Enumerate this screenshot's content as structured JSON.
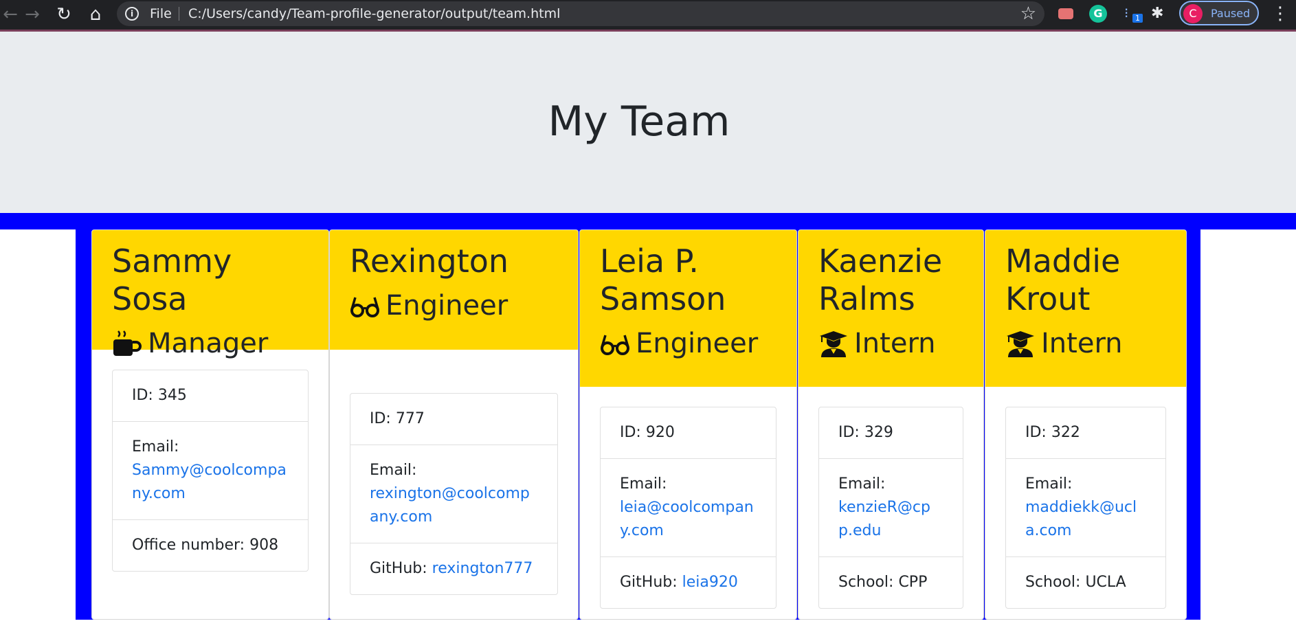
{
  "browser": {
    "file_label": "File",
    "url": "C:/Users/candy/Team-profile-generator/output/team.html",
    "profile_initial": "C",
    "profile_status": "Paused",
    "ext_badge_count": "1"
  },
  "page": {
    "title": "My Team"
  },
  "colors": {
    "header": "#ffd700",
    "band": "#0000ff",
    "link": "#1a73e8",
    "jumbotron": "#e9ecef"
  },
  "cards": [
    {
      "name": "Sammy Sosa",
      "role": "Manager",
      "role_icon": "mug-icon",
      "id_text": "ID: 345",
      "email_label": "Email:",
      "email": "Sammy@coolcompany.com",
      "extra_label": "Office number: 908",
      "extra_link": ""
    },
    {
      "name": "Rexington",
      "role": "Engineer",
      "role_icon": "glasses-icon",
      "id_text": "ID: 777",
      "email_label": "Email:",
      "email": "rexington@coolcompany.com",
      "extra_label": "GitHub:",
      "extra_link": "rexington777"
    },
    {
      "name": "Leia P. Samson",
      "role": "Engineer",
      "role_icon": "glasses-icon",
      "id_text": "ID: 920",
      "email_label": "Email:",
      "email": "leia@coolcompany.com",
      "extra_label": "GitHub:",
      "extra_link": "leia920"
    },
    {
      "name": "Kaenzie Ralms",
      "role": "Intern",
      "role_icon": "graduate-icon",
      "id_text": "ID: 329",
      "email_label": "Email:",
      "email": "kenzieR@cpp.edu",
      "extra_label": "School: CPP",
      "extra_link": ""
    },
    {
      "name": "Maddie Krout",
      "role": "Intern",
      "role_icon": "graduate-icon",
      "id_text": "ID: 322",
      "email_label": "Email:",
      "email": "maddiekk@ucla.com",
      "extra_label": "School: UCLA",
      "extra_link": ""
    }
  ]
}
